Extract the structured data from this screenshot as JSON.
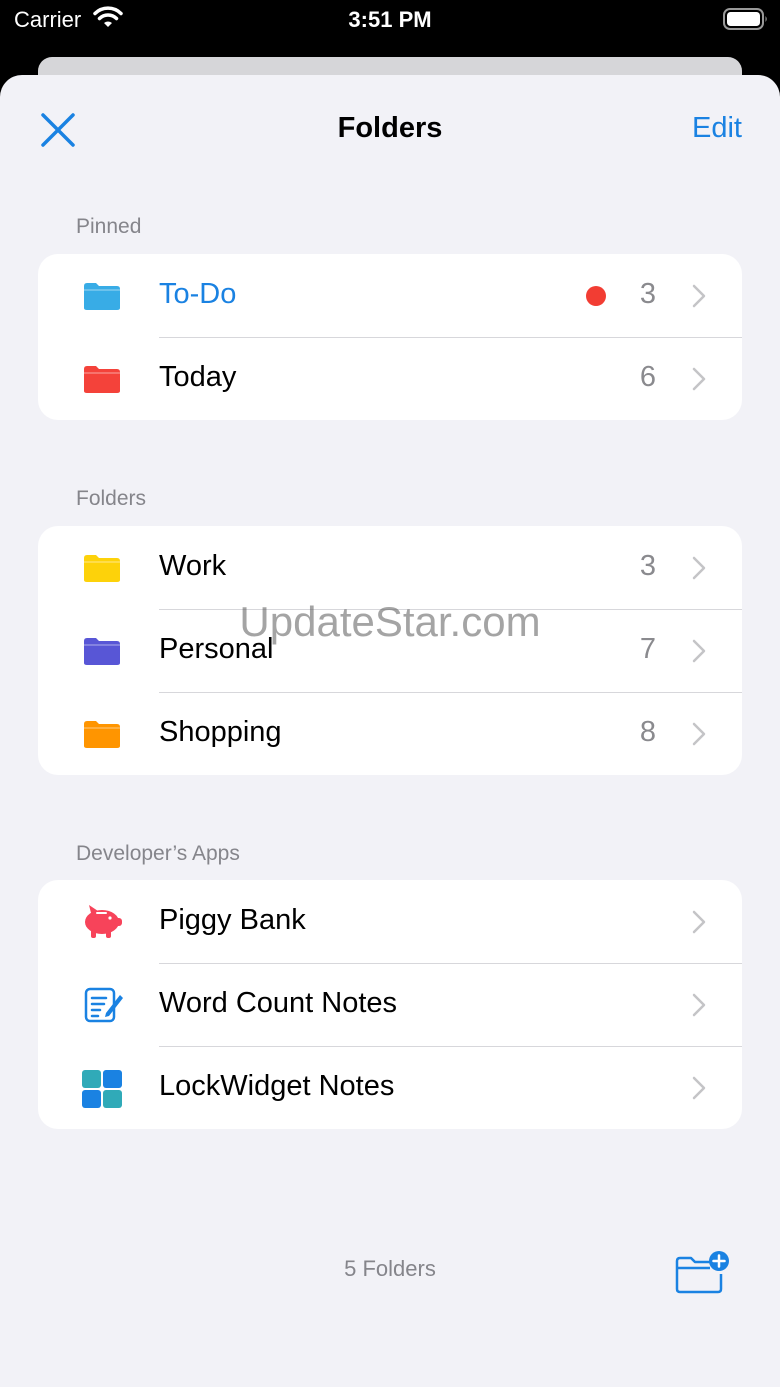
{
  "status_bar": {
    "carrier": "Carrier",
    "time": "3:51 PM"
  },
  "nav": {
    "close_icon": "close-icon",
    "title": "Folders",
    "edit_label": "Edit"
  },
  "sections": {
    "pinned": {
      "header": "Pinned",
      "rows": [
        {
          "label": "To-Do",
          "count": "3",
          "icon": "folder-icon",
          "color": "#38ace6",
          "dot_color": "#f23d33"
        },
        {
          "label": "Today",
          "count": "6",
          "icon": "folder-icon",
          "color": "#f4423a"
        }
      ]
    },
    "folders": {
      "header": "Folders",
      "rows": [
        {
          "label": "Work",
          "count": "3",
          "icon": "folder-icon",
          "color": "#fdd20a"
        },
        {
          "label": "Personal",
          "count": "7",
          "icon": "folder-icon",
          "color": "#5856d6"
        },
        {
          "label": "Shopping",
          "count": "8",
          "icon": "folder-icon",
          "color": "#ff9500"
        }
      ]
    },
    "developer_apps": {
      "header": "Developer’s Apps",
      "rows": [
        {
          "label": "Piggy Bank",
          "icon": "piggy-bank-icon",
          "color": "#f7435a"
        },
        {
          "label": "Word Count Notes",
          "icon": "word-count-notes-icon",
          "color": "#1a82e2"
        },
        {
          "label": "LockWidget Notes",
          "icon": "lockwidget-notes-icon",
          "color": "#1a82e2"
        }
      ]
    }
  },
  "watermark": "UpdateStar.com",
  "footer": {
    "folder_count": "5 Folders",
    "new_folder_icon": "new-folder-icon"
  },
  "colors": {
    "accent": "#1a82e2",
    "background": "#f2f2f7",
    "secondary_text": "#8a8a8e"
  }
}
